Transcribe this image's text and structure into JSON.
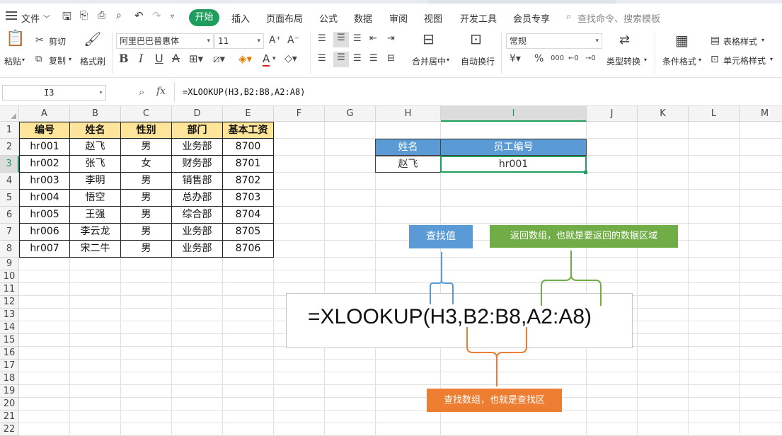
{
  "menu": {
    "file": "文件",
    "tabs": [
      "开始",
      "插入",
      "页面布局",
      "公式",
      "数据",
      "审阅",
      "视图",
      "开发工具",
      "会员专享"
    ],
    "search_placeholder": "查找命令、搜索模板"
  },
  "ribbon": {
    "paste": "粘贴",
    "cut": "剪切",
    "copy": "复制",
    "format_painter": "格式刷",
    "font_name": "阿里巴巴普惠体",
    "font_size": "11",
    "merge_center": "合并居中",
    "wrap_text": "自动换行",
    "number_format": "常规",
    "type_convert": "类型转换",
    "cond_format": "条件格式",
    "table_style": "表格样式",
    "cell_style": "单元格样式"
  },
  "formula_bar": {
    "name_box": "I3",
    "fx": "fx",
    "formula": "=XLOOKUP(H3,B2:B8,A2:A8)"
  },
  "columns": [
    "A",
    "B",
    "C",
    "D",
    "E",
    "F",
    "G",
    "H",
    "I",
    "J",
    "K",
    "L",
    "M"
  ],
  "rows": [
    "1",
    "2",
    "3",
    "4",
    "5",
    "6",
    "7",
    "8",
    "9",
    "10",
    "11",
    "12",
    "13",
    "14",
    "15",
    "16",
    "17",
    "18",
    "19",
    "20",
    "21",
    "22"
  ],
  "table": {
    "headers": [
      "编号",
      "姓名",
      "性别",
      "部门",
      "基本工资"
    ],
    "rows": [
      [
        "hr001",
        "赵飞",
        "男",
        "业务部",
        "8700"
      ],
      [
        "hr002",
        "张飞",
        "女",
        "财务部",
        "8701"
      ],
      [
        "hr003",
        "李明",
        "男",
        "销售部",
        "8702"
      ],
      [
        "hr004",
        "悟空",
        "男",
        "总办部",
        "8703"
      ],
      [
        "hr005",
        "王强",
        "男",
        "综合部",
        "8704"
      ],
      [
        "hr006",
        "李云龙",
        "男",
        "业务部",
        "8705"
      ],
      [
        "hr007",
        "宋二牛",
        "男",
        "业务部",
        "8706"
      ]
    ]
  },
  "lookup": {
    "header_name": "姓名",
    "header_id": "员工编号",
    "name_value": "赵飞",
    "result_value": "hr001"
  },
  "annotation": {
    "formula": "=XLOOKUP(H3,B2:B8,A2:A8)",
    "lookup_value": "查找值",
    "return_array": "返回数组，也就是要返回的数据区域",
    "lookup_array": "查找数组，也就是查找区"
  },
  "colors": {
    "accent_green": "#1f9d5e",
    "header_yellow": "#ffe59a",
    "lookup_blue": "#5b9bd5",
    "callout_green": "#70ad47",
    "callout_orange": "#ed7d31"
  }
}
